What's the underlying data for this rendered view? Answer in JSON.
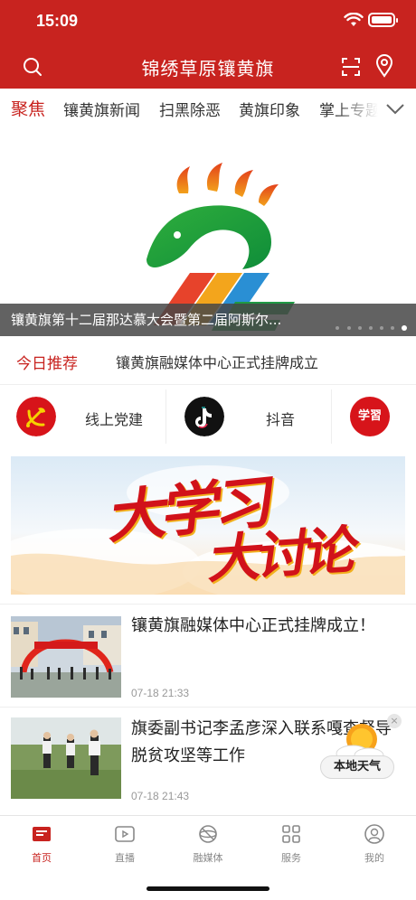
{
  "status_bar": {
    "time": "15:09"
  },
  "header": {
    "title": "锦绣草原镶黄旗"
  },
  "tabs": [
    {
      "label": "聚焦",
      "active": true
    },
    {
      "label": "镶黄旗新闻"
    },
    {
      "label": "扫黑除恶"
    },
    {
      "label": "黄旗印象"
    },
    {
      "label": "掌上专题"
    }
  ],
  "banner": {
    "caption": "镶黄旗第十二届那达慕大会暨第二届阿斯尔...",
    "logo_text": "22"
  },
  "recommend": {
    "label": "今日推荐",
    "headline": "镶黄旗融媒体中心正式挂牌成立"
  },
  "quick_links": [
    {
      "label": "线上党建",
      "icon": "party-emblem-icon"
    },
    {
      "label": "抖音",
      "icon": "tiktok-icon"
    },
    {
      "label": "",
      "icon": "xuexi-icon",
      "icon_text": "学習"
    }
  ],
  "poster": {
    "text_1": "大学习",
    "text_2": "大讨论"
  },
  "news": [
    {
      "title": "镶黄旗融媒体中心正式挂牌成立！",
      "time": "07-18 21:33"
    },
    {
      "title": "旗委副书记李孟彦深入联系嘎查督导脱贫攻坚等工作",
      "time": "07-18 21:43"
    }
  ],
  "weather_widget": {
    "label": "本地天气",
    "close": "×"
  },
  "bottom_nav": [
    {
      "label": "首页",
      "icon": "home-icon",
      "active": true
    },
    {
      "label": "直播",
      "icon": "live-play-icon"
    },
    {
      "label": "融媒体",
      "icon": "media-icon"
    },
    {
      "label": "服务",
      "icon": "services-grid-icon"
    },
    {
      "label": "我的",
      "icon": "profile-icon"
    }
  ],
  "colors": {
    "brand_red": "#c8231f",
    "text": "#333333",
    "muted": "#999999"
  }
}
